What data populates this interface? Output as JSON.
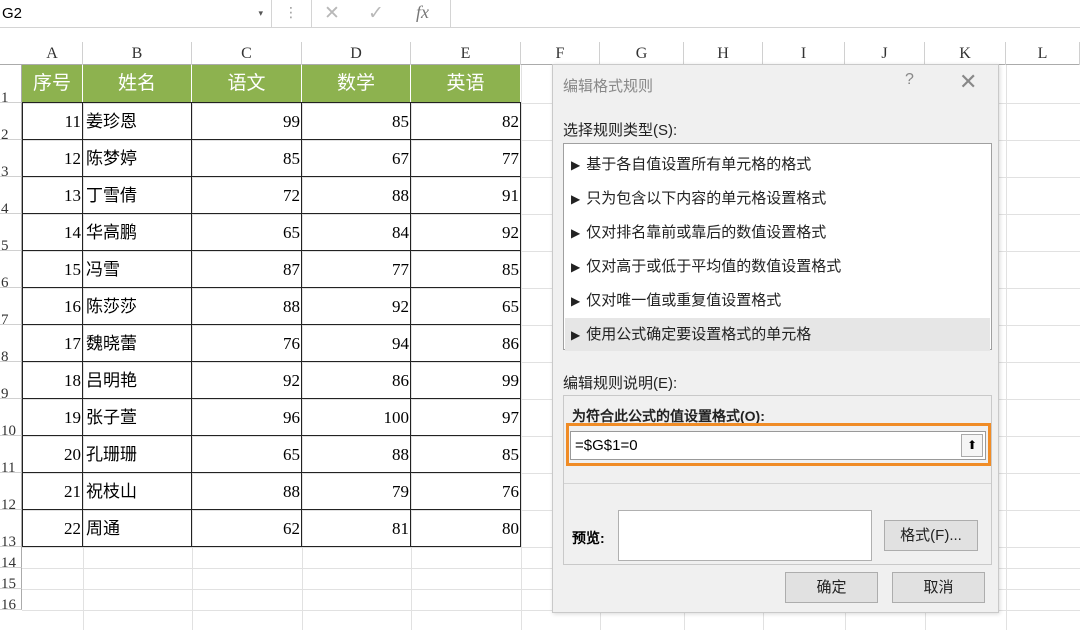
{
  "formula_bar": {
    "name_box": "G2",
    "dropdown": "▾",
    "dots": "⋮",
    "cancel_icon": "✕",
    "confirm_icon": "✓",
    "fx": "fx",
    "content": ""
  },
  "columns": [
    "A",
    "B",
    "C",
    "D",
    "E",
    "F",
    "G",
    "H",
    "I",
    "J",
    "K",
    "L"
  ],
  "rows": [
    "1",
    "2",
    "3",
    "4",
    "5",
    "6",
    "7",
    "8",
    "9",
    "10",
    "11",
    "12",
    "13",
    "14",
    "15",
    "16"
  ],
  "table": {
    "headers": [
      "序号",
      "姓名",
      "语文",
      "数学",
      "英语"
    ],
    "rows": [
      [
        "11",
        "姜珍恩",
        "99",
        "85",
        "82"
      ],
      [
        "12",
        "陈梦婷",
        "85",
        "67",
        "77"
      ],
      [
        "13",
        "丁雪倩",
        "72",
        "88",
        "91"
      ],
      [
        "14",
        "华高鹏",
        "65",
        "84",
        "92"
      ],
      [
        "15",
        "冯雪",
        "87",
        "77",
        "85"
      ],
      [
        "16",
        "陈莎莎",
        "88",
        "92",
        "65"
      ],
      [
        "17",
        "魏晓蕾",
        "76",
        "94",
        "86"
      ],
      [
        "18",
        "吕明艳",
        "92",
        "86",
        "99"
      ],
      [
        "19",
        "张子萱",
        "96",
        "100",
        "97"
      ],
      [
        "20",
        "孔珊珊",
        "65",
        "88",
        "85"
      ],
      [
        "21",
        "祝枝山",
        "88",
        "79",
        "76"
      ],
      [
        "22",
        "周通",
        "62",
        "81",
        "80"
      ]
    ],
    "header_color": "#8db24f"
  },
  "dialog": {
    "title": "编辑格式规则",
    "help": "?",
    "close": "✕",
    "select_type_label": "选择规则类型(S):",
    "rule_types": [
      "基于各自值设置所有单元格的格式",
      "只为包含以下内容的单元格设置格式",
      "仅对排名靠前或靠后的数值设置格式",
      "仅对高于或低于平均值的数值设置格式",
      "仅对唯一值或重复值设置格式",
      "使用公式确定要设置格式的单元格"
    ],
    "selected_rule_index": 5,
    "rule_arrow": "▶",
    "edit_desc_label": "编辑规则说明(E):",
    "formula_label": "为符合此公式的值设置格式(O):",
    "formula_value": "=$G$1=0",
    "collapse_icon": "⬆",
    "preview_label": "预览:",
    "format_button": "格式(F)...",
    "ok_button": "确定",
    "cancel_button": "取消",
    "highlight_color": "#f08c26"
  }
}
